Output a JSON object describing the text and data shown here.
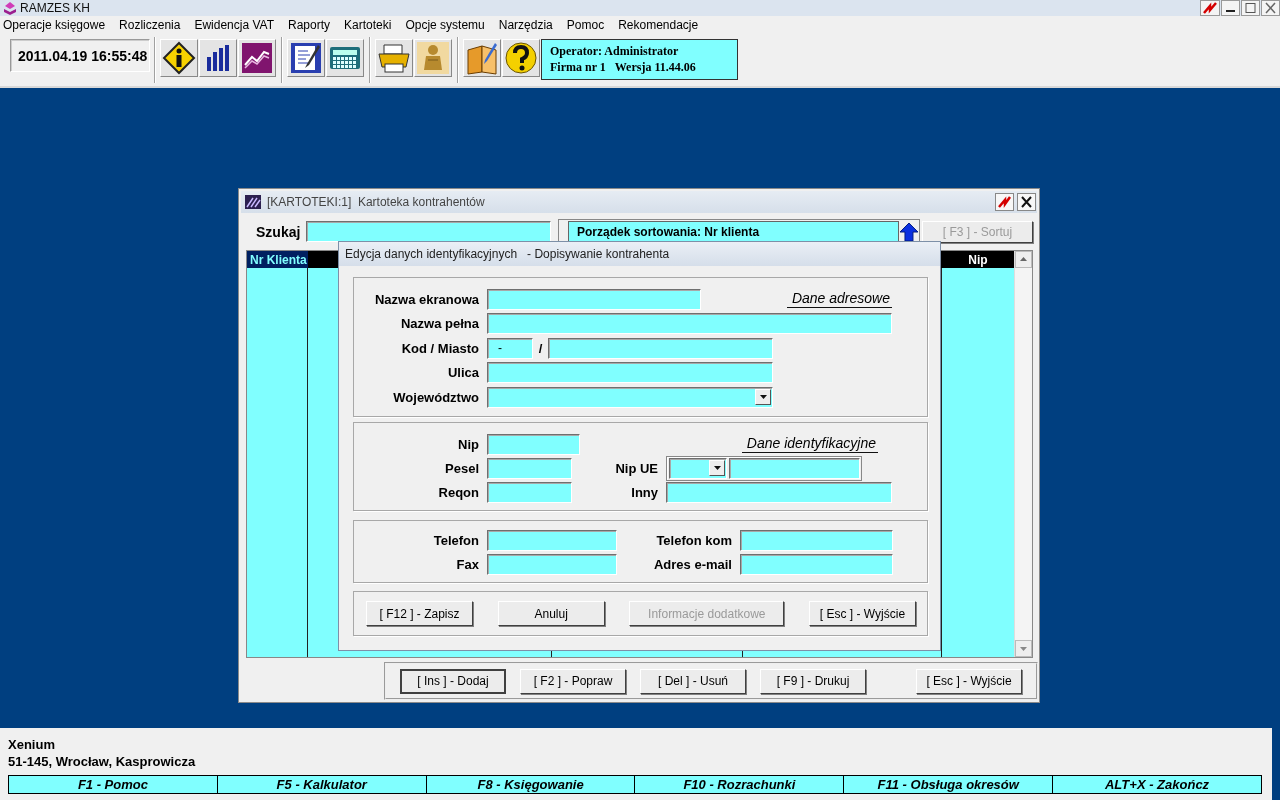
{
  "app_window": {
    "title": "RAMZES KH"
  },
  "menu": [
    "Operacje księgowe",
    "Rozliczenia",
    "Ewidencja VAT",
    "Raporty",
    "Kartoteki",
    "Opcje systemu",
    "Narzędzia",
    "Pomoc",
    "Rekomendacje"
  ],
  "toolbar": {
    "datetime": "2011.04.19 16:55:48",
    "operator": "Operator: Administrator",
    "firm": "Firma nr 1",
    "version": "Wersja 11.44.06"
  },
  "list_window": {
    "title": "[KARTOTEKI:1]  Kartoteka kontrahentów",
    "search_label": "Szukaj",
    "sort_label": "Porządek sortowania: Nr klienta",
    "sort_button": {
      "label": "[ F3 ] - Sortuj",
      "disabled": true
    },
    "columns": [
      {
        "label": "Nr Klienta",
        "sorted": true
      },
      {
        "label": "Nip",
        "sorted": false
      }
    ],
    "buttons": [
      {
        "label": "[ Ins ] - Dodaj",
        "focused": true
      },
      {
        "label": "[ F2 ] - Popraw",
        "focused": false
      },
      {
        "label": "[ Del ] - Usuń",
        "focused": false
      },
      {
        "label": "[ F9 ] - Drukuj",
        "focused": false
      },
      {
        "label": "[ Esc ] - Wyjście",
        "focused": false
      }
    ]
  },
  "dialog": {
    "title": "Edycja danych identyfikacyjnych   - Dopisywanie kontrahenta",
    "sections": [
      {
        "heading": "Dane adresowe",
        "fields": [
          {
            "label": "Nazwa ekranowa",
            "kind": "text"
          },
          {
            "label": "Nazwa pełna",
            "kind": "text"
          },
          {
            "label": "Kod / Miasto",
            "kind": "postal_city",
            "value": "-",
            "separator": "/"
          },
          {
            "label": "Ulica",
            "kind": "text"
          },
          {
            "label": "Województwo",
            "kind": "dropdown"
          }
        ]
      },
      {
        "heading": "Dane identyfikacyjne",
        "fields": [
          {
            "label": "Nip",
            "kind": "text"
          },
          {
            "label": "Pesel",
            "kind": "text"
          },
          {
            "label": "Reqon",
            "kind": "text"
          },
          {
            "label": "Nip UE",
            "kind": "combo"
          },
          {
            "label": "Inny",
            "kind": "text"
          }
        ]
      },
      {
        "fields": [
          {
            "label": "Telefon",
            "kind": "text"
          },
          {
            "label": "Telefon kom",
            "kind": "text"
          },
          {
            "label": "Fax",
            "kind": "text"
          },
          {
            "label": "Adres e-mail",
            "kind": "text"
          }
        ]
      }
    ],
    "buttons": [
      {
        "label": "[ F12 ] - Zapisz",
        "disabled": false
      },
      {
        "label": "Anuluj",
        "disabled": false
      },
      {
        "label": "Informacje dodatkowe",
        "disabled": true
      },
      {
        "label": "[ Esc ] - Wyjście",
        "disabled": false
      }
    ]
  },
  "status": {
    "company": "Xenium",
    "address": "51-145, Wrocław, Kasprowicza"
  },
  "function_keys": [
    "F1 - Pomoc",
    "F5 - Kalkulator",
    "F8 - Księgowanie",
    "F10 - Rozrachunki",
    "F11 - Obsługa okresów",
    "ALT+X - Zakończ"
  ]
}
